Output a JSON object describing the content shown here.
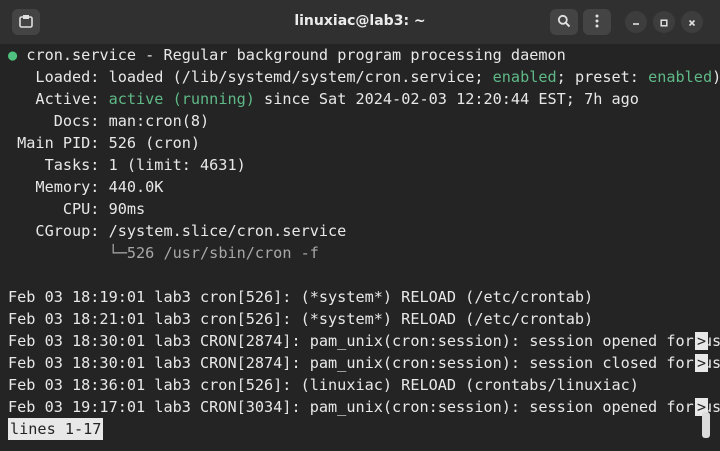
{
  "window": {
    "title": "linuxiac@lab3: ~"
  },
  "icons": {
    "new_tab": "terminal-new-tab-icon",
    "search": "search-icon",
    "menu": "kebab-menu-icon",
    "minimize": "minimize-icon",
    "maximize": "maximize-icon",
    "close": "close-icon"
  },
  "service": {
    "bullet": "●",
    "header": "cron.service - Regular background program processing daemon",
    "loaded_label": "   Loaded: ",
    "loaded_pre": "loaded (/lib/systemd/system/cron.service; ",
    "loaded_enabled": "enabled",
    "loaded_mid": "; preset: ",
    "loaded_preset": "enabled",
    "loaded_post": ")",
    "active_label": "   Active: ",
    "active_state": "active (running)",
    "active_rest": " since Sat 2024-02-03 12:20:44 EST; 7h ago",
    "docs": "     Docs: man:cron(8)",
    "main_pid": " Main PID: 526 (cron)",
    "tasks": "    Tasks: 1 (limit: 4631)",
    "memory": "   Memory: 440.0K",
    "cpu": "      CPU: 90ms",
    "cgroup": "   CGroup: /system.slice/cron.service",
    "cgroup_child_indent": "           ",
    "cgroup_child": "└─526 /usr/sbin/cron -f"
  },
  "logs": [
    "Feb 03 18:19:01 lab3 cron[526]: (*system*) RELOAD (/etc/crontab)",
    "Feb 03 18:21:01 lab3 cron[526]: (*system*) RELOAD (/etc/crontab)",
    "Feb 03 18:30:01 lab3 CRON[2874]: pam_unix(cron:session): session opened for user",
    "Feb 03 18:30:01 lab3 CRON[2874]: pam_unix(cron:session): session closed for user",
    "Feb 03 18:36:01 lab3 cron[526]: (linuxiac) RELOAD (crontabs/linuxiac)",
    "Feb 03 19:17:01 lab3 CRON[3034]: pam_unix(cron:session): session opened for user"
  ],
  "overflow_marker": ">",
  "pager_status": "lines 1-17",
  "colors": {
    "background": "#242424",
    "titlebar": "#303030",
    "green": "#5fb987",
    "text": "#e8e8e8"
  }
}
